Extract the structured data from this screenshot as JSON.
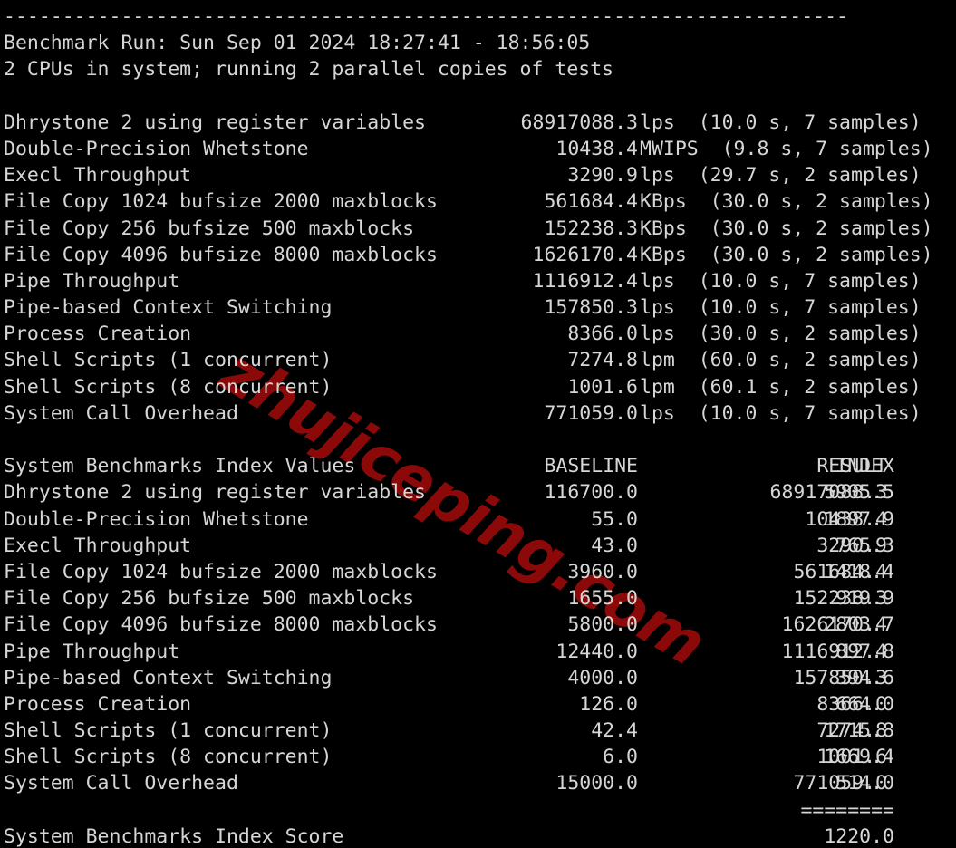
{
  "terminal": {
    "background_color": "#000000",
    "text_color": "#d6d6d6",
    "divider": "------------------------------------------------------------------------",
    "header": {
      "run_line": "Benchmark Run: Sun Sep 01 2024 18:27:41 - 18:56:05",
      "cpu_line": "2 CPUs in system; running 2 parallel copies of tests"
    },
    "results": {
      "rows": [
        {
          "label": "Dhrystone 2 using register variables",
          "value": "68917088.3",
          "unit": "lps",
          "detail": "(10.0 s, 7 samples)"
        },
        {
          "label": "Double-Precision Whetstone",
          "value": "10438.4",
          "unit": "MWIPS",
          "detail": "(9.8 s, 7 samples)"
        },
        {
          "label": "Execl Throughput",
          "value": "3290.9",
          "unit": "lps",
          "detail": "(29.7 s, 2 samples)"
        },
        {
          "label": "File Copy 1024 bufsize 2000 maxblocks",
          "value": "561684.4",
          "unit": "KBps",
          "detail": "(30.0 s, 2 samples)"
        },
        {
          "label": "File Copy 256 bufsize 500 maxblocks",
          "value": "152238.3",
          "unit": "KBps",
          "detail": "(30.0 s, 2 samples)"
        },
        {
          "label": "File Copy 4096 bufsize 8000 maxblocks",
          "value": "1626170.4",
          "unit": "KBps",
          "detail": "(30.0 s, 2 samples)"
        },
        {
          "label": "Pipe Throughput",
          "value": "1116912.4",
          "unit": "lps",
          "detail": "(10.0 s, 7 samples)"
        },
        {
          "label": "Pipe-based Context Switching",
          "value": "157850.3",
          "unit": "lps",
          "detail": "(10.0 s, 7 samples)"
        },
        {
          "label": "Process Creation",
          "value": "8366.0",
          "unit": "lps",
          "detail": "(30.0 s, 2 samples)"
        },
        {
          "label": "Shell Scripts (1 concurrent)",
          "value": "7274.8",
          "unit": "lpm",
          "detail": "(60.0 s, 2 samples)"
        },
        {
          "label": "Shell Scripts (8 concurrent)",
          "value": "1001.6",
          "unit": "lpm",
          "detail": "(60.1 s, 2 samples)"
        },
        {
          "label": "System Call Overhead",
          "value": "771059.0",
          "unit": "lps",
          "detail": "(10.0 s, 7 samples)"
        }
      ]
    },
    "index_table": {
      "title": "System Benchmarks Index Values",
      "headers": {
        "baseline": "BASELINE",
        "result": "RESULT",
        "index": "INDEX"
      },
      "rows": [
        {
          "label": "Dhrystone 2 using register variables",
          "baseline": "116700.0",
          "result": "68917088.3",
          "index": "5905.5"
        },
        {
          "label": "Double-Precision Whetstone",
          "baseline": "55.0",
          "result": "10438.4",
          "index": "1897.9"
        },
        {
          "label": "Execl Throughput",
          "baseline": "43.0",
          "result": "3290.9",
          "index": "765.3"
        },
        {
          "label": "File Copy 1024 bufsize 2000 maxblocks",
          "baseline": "3960.0",
          "result": "561684.4",
          "index": "1418.4"
        },
        {
          "label": "File Copy 256 bufsize 500 maxblocks",
          "baseline": "1655.0",
          "result": "152238.3",
          "index": "919.9"
        },
        {
          "label": "File Copy 4096 bufsize 8000 maxblocks",
          "baseline": "5800.0",
          "result": "1626170.4",
          "index": "2803.7"
        },
        {
          "label": "Pipe Throughput",
          "baseline": "12440.0",
          "result": "1116912.4",
          "index": "897.8"
        },
        {
          "label": "Pipe-based Context Switching",
          "baseline": "4000.0",
          "result": "157850.3",
          "index": "394.6"
        },
        {
          "label": "Process Creation",
          "baseline": "126.0",
          "result": "8366.0",
          "index": "664.0"
        },
        {
          "label": "Shell Scripts (1 concurrent)",
          "baseline": "42.4",
          "result": "7274.8",
          "index": "1715.8"
        },
        {
          "label": "Shell Scripts (8 concurrent)",
          "baseline": "6.0",
          "result": "1001.6",
          "index": "1669.4"
        },
        {
          "label": "System Call Overhead",
          "baseline": "15000.0",
          "result": "771059.0",
          "index": "514.0"
        }
      ],
      "score_rule": "========",
      "score_label": "System Benchmarks Index Score",
      "score_value": "1220.0"
    }
  },
  "watermark": {
    "text": "zhujiceping.com",
    "color": "#8c0909"
  }
}
